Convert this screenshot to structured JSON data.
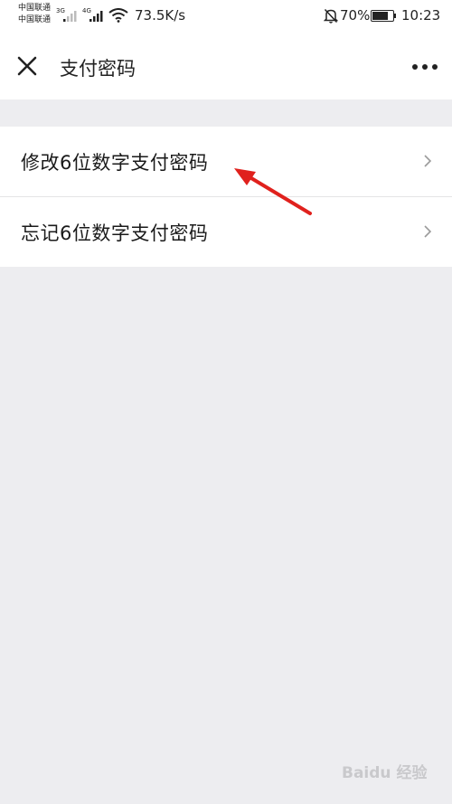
{
  "status_bar": {
    "carrier_1": "中国联通",
    "carrier_2": "中国联通",
    "net_1": "3G",
    "net_2": "4G",
    "speed": "73.5K/s",
    "battery": "70%",
    "battery_level": 0.7,
    "time": "10:23"
  },
  "nav": {
    "title": "支付密码"
  },
  "menu": {
    "items": [
      {
        "label": "修改6位数字支付密码"
      },
      {
        "label": "忘记6位数字支付密码"
      }
    ]
  },
  "watermark": "Baidu 经验",
  "colors": {
    "background": "#ededf0",
    "surface": "#ffffff",
    "annotation_arrow": "#e0211d"
  }
}
